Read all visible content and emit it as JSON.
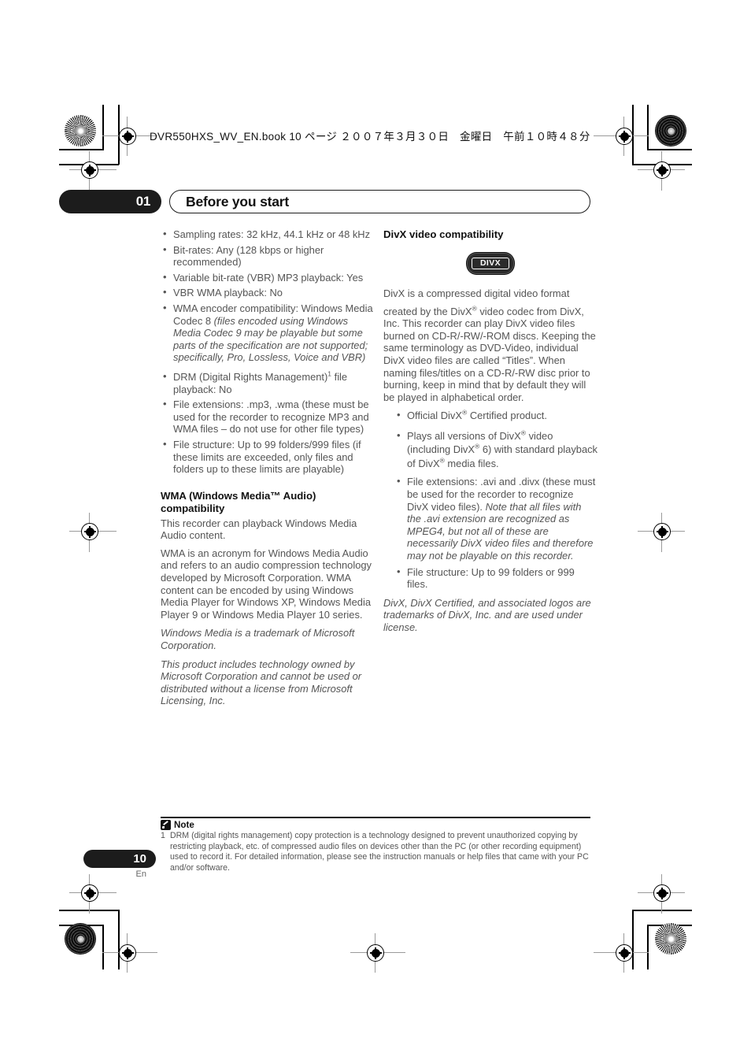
{
  "running_header": {
    "text": "DVR550HXS_WV_EN.book  10 ページ  ２００７年３月３０日　金曜日　午前１０時４８分"
  },
  "chapter": {
    "number": "01",
    "title": "Before you start"
  },
  "left_column": {
    "mp3_bullets": [
      "Sampling rates: 32 kHz, 44.1 kHz or 48 kHz",
      "Bit-rates: Any (128 kbps or higher recommended)",
      "Variable bit-rate (VBR) MP3 playback: Yes",
      "VBR WMA playback: No"
    ],
    "wma_encoder_bullet": {
      "roman": "WMA encoder compatibility: Windows Media Codec 8 ",
      "italic": "(files encoded using Windows Media Codec 9 may be playable but some parts of the specification are not supported; specifically, Pro, Lossless, Voice and VBR)"
    },
    "drm_bullet": {
      "before_sup": "DRM (Digital Rights Management)",
      "sup": "1",
      "after_sup": " file playback: No"
    },
    "more_bullets": [
      "File extensions: .mp3, .wma (these must be used for the recorder to recognize MP3 and WMA files – do not use for other file types)",
      "File structure: Up to 99 folders/999 files (if these limits are exceeded, only files and folders up to these limits are playable)"
    ],
    "wma_heading": "WMA (Windows Media™ Audio) compatibility",
    "wma_paragraphs": [
      "This recorder can playback Windows Media Audio content.",
      "WMA is an acronym for Windows Media Audio and refers to an audio compression technology developed by Microsoft Corporation. WMA content can be encoded by using Windows Media Player for Windows XP, Windows Media Player 9 or Windows Media Player 10 series."
    ],
    "wma_italic_paragraphs": [
      "Windows Media is a trademark of Microsoft Corporation.",
      "This product includes technology owned by Microsoft Corporation and cannot be used or distributed without a license from Microsoft Licensing, Inc."
    ]
  },
  "right_column": {
    "divx_heading": "DivX video compatibility",
    "logo_text": "DIVX",
    "intro_line1": "DivX is a compressed digital video format",
    "intro_part_a": "created by the DivX",
    "intro_sup": "®",
    "intro_part_b": " video codec from DivX, Inc. This recorder can play DivX video files burned on CD-R/-RW/-ROM discs. Keeping the same terminology as DVD-Video, individual DivX video files are called “Titles”. When naming files/titles on a CD-R/-RW disc prior to burning, keep in mind that by default they will be played in alphabetical order.",
    "bullet_official": {
      "a": "Official DivX",
      "sup": "®",
      "b": " Certified product."
    },
    "bullet_versions": {
      "a": "Plays all versions of DivX",
      "sup1": "®",
      "b": " video (including DivX",
      "sup2": "®",
      "c": " 6) with standard playback of DivX",
      "sup3": "®",
      "d": " media files."
    },
    "bullet_extensions": {
      "roman": "File extensions: .avi and .divx (these must be used for the recorder to recognize DivX video files). ",
      "italic": "Note that all files with the .avi extension are recognized as MPEG4, but not all of these are necessarily DivX video files and therefore may not be playable on this recorder."
    },
    "bullet_structure": "File structure: Up to 99 folders or 999 files.",
    "trademark_note": "DivX, DivX Certified, and associated logos are trademarks of DivX, Inc. and are used under license."
  },
  "footnote": {
    "label": "Note",
    "number": "1",
    "text": "DRM (digital rights management) copy protection is a technology designed to prevent unauthorized copying by restricting playback, etc. of compressed audio files on devices other than the PC (or other recording equipment) used to record it. For detailed information, please see the instruction manuals or help files that came with your PC and/or software."
  },
  "page_footer": {
    "page_number": "10",
    "language": "En"
  },
  "colors": {
    "ink_black": "#1c1c1c",
    "body_gray": "#555555"
  }
}
